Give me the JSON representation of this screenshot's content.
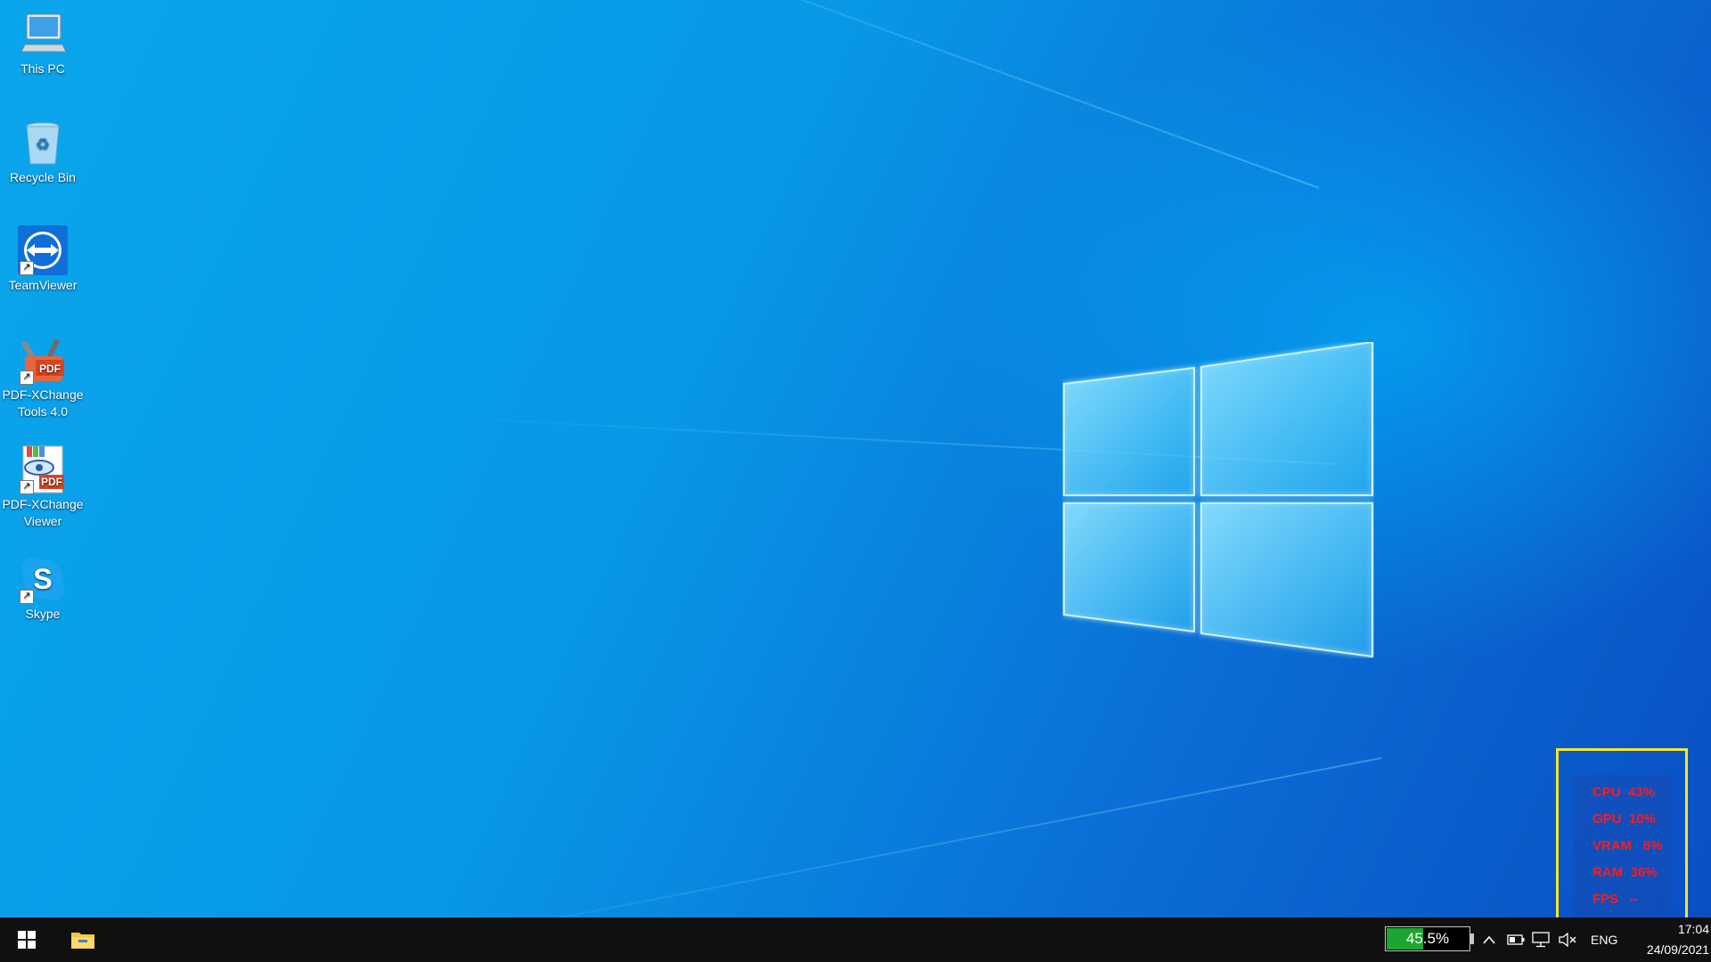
{
  "desktop": {
    "icons": [
      {
        "label": "This PC",
        "icon": "computer-icon"
      },
      {
        "label": "Recycle Bin",
        "icon": "recycle-bin-icon"
      },
      {
        "label": "TeamViewer",
        "icon": "teamviewer-icon"
      },
      {
        "label_line1": "PDF-XChange",
        "label_line2": "Tools 4.0",
        "icon": "pdf-xchange-tools-icon"
      },
      {
        "label_line1": "PDF-XChange",
        "label_line2": "Viewer",
        "icon": "pdf-xchange-viewer-icon"
      },
      {
        "label": "Skype",
        "icon": "skype-icon"
      }
    ],
    "pdf_badge": "PDF",
    "skype_letter": "S",
    "shortcut_glyph": "↗"
  },
  "overlay": {
    "border_color": "#f7e52a",
    "text_color": "#ff1a1a",
    "stats": [
      {
        "text": "CPU  43%"
      },
      {
        "text": "GPU  10%"
      },
      {
        "text": "VRAM   8%"
      },
      {
        "text": "RAM  36%"
      },
      {
        "text": "FPS   --"
      }
    ]
  },
  "taskbar": {
    "battery": {
      "text": "45.5%",
      "level_percent": 45.5,
      "fill_color": "#1aa631"
    },
    "language": "ENG",
    "time": "17:04",
    "date": "24/09/2021"
  }
}
